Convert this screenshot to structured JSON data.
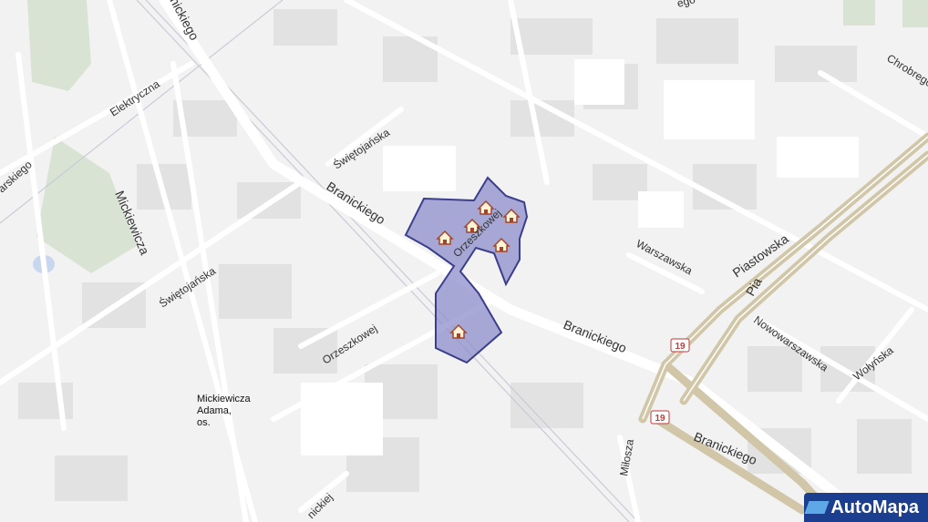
{
  "map": {
    "streets": {
      "branickiego_top": "Branickiego",
      "branickiego_mid": "Branickiego",
      "branickiego_bottom": "Branickiego",
      "branickiego_north": "nickiego",
      "elektryczna": "Elektryczna",
      "mickiewicza": "Mickiewicza",
      "swietojanska_top": "Świętojańska",
      "swietojanska_left": "Świętojańska",
      "orzeszkowej_area": "Orzeszkowej",
      "orzeszkowej_left": "Orzeszkowej",
      "warszawska": "Warszawska",
      "piastowska": "Piastowska",
      "piastowska_vertical": "Pia",
      "nowowarszawska": "Nowowarszawska",
      "wolynska": "Wołyńska",
      "milosza": "Miłosza",
      "chrobrego": "Chrobrego",
      "arskiego": "arskiego",
      "nickiej": "nickiej",
      "top_edge": "ego"
    },
    "route_badges": [
      "19",
      "19"
    ],
    "place_label": [
      "Mickiewicza",
      "Adama,",
      "os."
    ],
    "marker_icon": "house-icon",
    "area_color": "#8c8ecb",
    "road_color": "#ffffff",
    "main_road_color": "#d1c7a8"
  },
  "branding": {
    "logo_text": "AutoMapa"
  }
}
